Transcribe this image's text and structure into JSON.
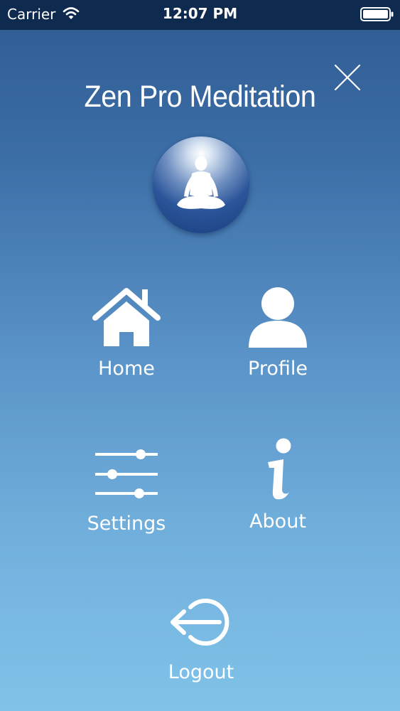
{
  "status_bar": {
    "carrier": "Carrier",
    "time": "12:07 PM"
  },
  "header": {
    "title": "Zen Pro Meditation"
  },
  "menu": {
    "home_label": "Home",
    "profile_label": "Profile",
    "settings_label": "Settings",
    "about_label": "About",
    "logout_label": "Logout"
  },
  "icons": {
    "close": "close-icon",
    "logo": "meditation-figure-icon",
    "home": "home-icon",
    "profile": "user-icon",
    "settings": "sliders-icon",
    "about": "info-icon",
    "logout": "logout-icon"
  },
  "colors": {
    "status_bar": "#0f2a4f",
    "gradient_top": "#2f5a92",
    "gradient_bottom": "#80c2e8",
    "foreground": "#ffffff"
  }
}
